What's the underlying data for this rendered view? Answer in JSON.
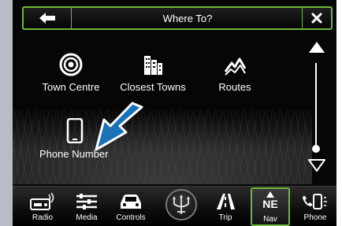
{
  "header": {
    "title": "Where To?",
    "back_icon": "back-arrow-icon",
    "close_icon": "close-icon"
  },
  "options": [
    {
      "label": "Town Centre",
      "icon": "town-centre-icon"
    },
    {
      "label": "Closest Towns",
      "icon": "closest-towns-icon"
    },
    {
      "label": "Routes",
      "icon": "routes-icon"
    },
    {
      "label": "Phone Number",
      "icon": "phone-icon"
    }
  ],
  "scroll": {
    "up_icon": "scroll-up-icon",
    "down_icon": "scroll-down-icon"
  },
  "bottom_bar": {
    "tabs": [
      {
        "label": "Radio",
        "icon": "radio-icon"
      },
      {
        "label": "Media",
        "icon": "media-icon"
      },
      {
        "label": "Controls",
        "icon": "controls-icon"
      },
      {
        "label": "Trip",
        "icon": "trip-icon"
      },
      {
        "label": "Nav",
        "icon": "compass-icon",
        "compass": "NE",
        "active": true
      },
      {
        "label": "Phone",
        "icon": "phone-tab-icon"
      }
    ],
    "logo": "trident-logo-icon"
  },
  "colors": {
    "accent": "#6eb83a",
    "callout": "#1a72b8",
    "background": "#060606",
    "side_strip": "#b9bcc7"
  }
}
